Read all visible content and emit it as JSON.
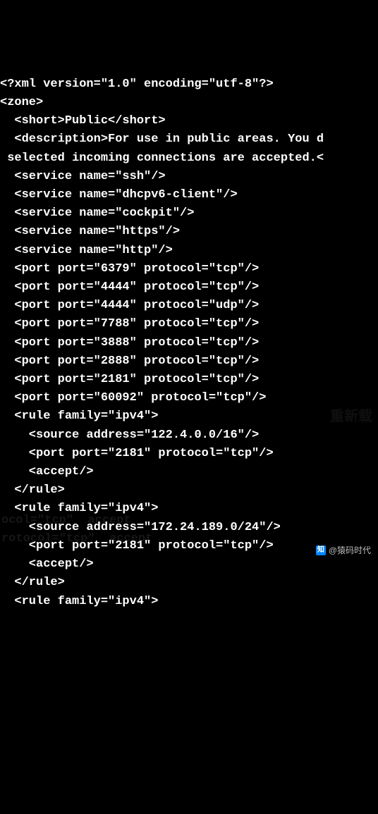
{
  "lines": [
    "<?xml version=\"1.0\" encoding=\"utf-8\"?>",
    "<zone>",
    "  <short>Public</short>",
    "  <description>For use in public areas. You d",
    " selected incoming connections are accepted.<",
    "  <service name=\"ssh\"/>",
    "  <service name=\"dhcpv6-client\"/>",
    "  <service name=\"cockpit\"/>",
    "  <service name=\"https\"/>",
    "  <service name=\"http\"/>",
    "  <port port=\"6379\" protocol=\"tcp\"/>",
    "  <port port=\"4444\" protocol=\"tcp\"/>",
    "  <port port=\"4444\" protocol=\"udp\"/>",
    "  <port port=\"7788\" protocol=\"tcp\"/>",
    "  <port port=\"3888\" protocol=\"tcp\"/>",
    "  <port port=\"2888\" protocol=\"tcp\"/>",
    "  <port port=\"2181\" protocol=\"tcp\"/>",
    "  <port port=\"60092\" protocol=\"tcp\"/>",
    "  <rule family=\"ipv4\">",
    "    <source address=\"122.4.0.0/16\"/>",
    "    <port port=\"2181\" protocol=\"tcp\"/>",
    "    <accept/>",
    "  </rule>",
    "  <rule family=\"ipv4\">",
    "    <source address=\"172.24.189.0/24\"/>",
    "    <port port=\"2181\" protocol=\"tcp\"/>",
    "    <accept/>",
    "  </rule>",
    "  <rule family=\"ipv4\">"
  ],
  "watermark": {
    "icon_text": "知",
    "text": "@猿码时代"
  },
  "faint_bg": {
    "l1": "ocol=\"tcp\"  accept",
    "l2": "rotocol=\"tcp\"  accept",
    "l3": "重新载"
  }
}
